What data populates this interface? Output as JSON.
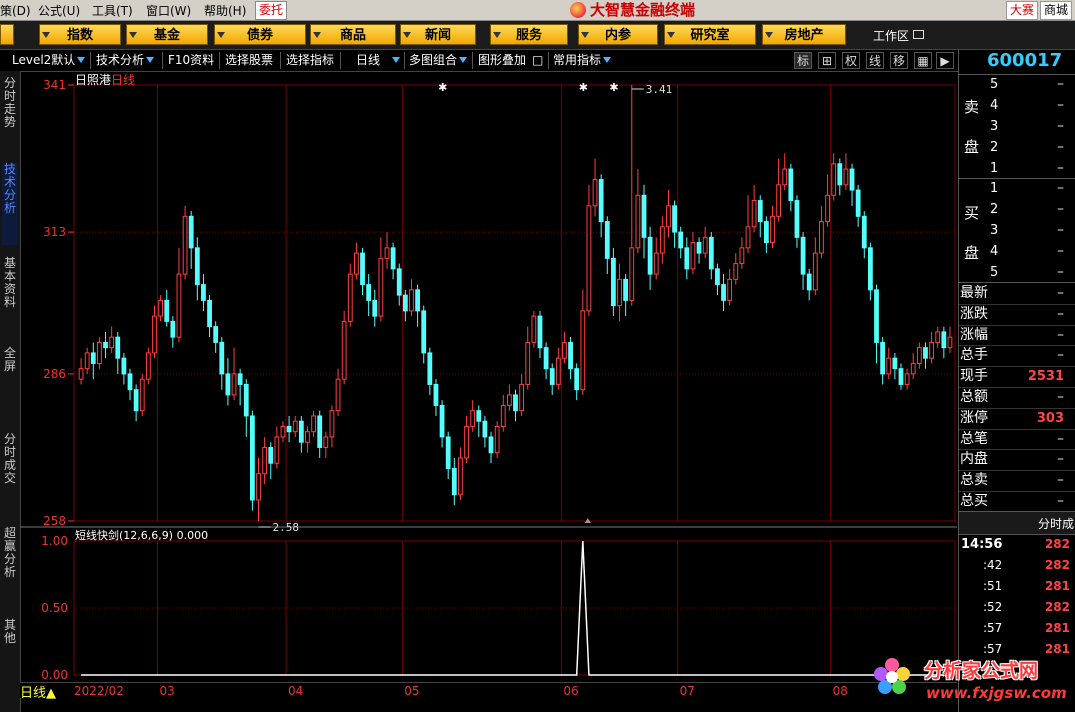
{
  "menu": {
    "items": [
      "策(D)",
      "公式(U)",
      "工具(T)",
      "窗口(W)",
      "帮助(H)"
    ],
    "weituo": "委托",
    "brand": "大智慧金融终端",
    "right_buttons": [
      "大赛",
      "商城"
    ]
  },
  "nav": {
    "items": [
      "指数",
      "基金",
      "债券",
      "商品",
      "新闻",
      "服务",
      "内参",
      "研究室",
      "房地产"
    ],
    "workzone": "工作区"
  },
  "toolbar": {
    "level2": "Level2默认",
    "tech": "技术分析",
    "f10": "F10资料",
    "select_stock": "选择股票",
    "select_ind": "选择指标",
    "period": "日线",
    "multi": "多图组合",
    "overlay": "图形叠加",
    "common_ind": "常用指标",
    "icons": [
      "标",
      "⊞",
      "权",
      "线",
      "移"
    ]
  },
  "left_tabs": [
    {
      "label": "分时走势",
      "active": false
    },
    {
      "label": "技术分析",
      "active": true
    },
    {
      "label": "基本资料",
      "active": false
    },
    {
      "label": "全屏",
      "active": false
    },
    {
      "label": "分时成交",
      "active": false
    },
    {
      "label": "超赢分析",
      "active": false
    },
    {
      "label": "其他",
      "active": false
    }
  ],
  "chart_data": {
    "type": "candlestick",
    "title": "日照港",
    "period_label": "日线",
    "indicator_name": "短线快剑(12,6,6,9)",
    "indicator_value": "0.000",
    "ylim": [
      2.58,
      3.41
    ],
    "y_ticks": [
      "341",
      "313",
      "286",
      "258"
    ],
    "y_tick_values": [
      3.41,
      3.13,
      2.86,
      2.58
    ],
    "indicator_ylim": [
      0,
      1
    ],
    "indicator_ticks": [
      "1.00",
      "0.50",
      "0.00"
    ],
    "high_marker": "3.41",
    "low_marker": "2.58",
    "x_labels": [
      "2022/02",
      "03",
      "04",
      "05",
      "06",
      "07",
      "08"
    ],
    "bottom_period": "日线",
    "colors": {
      "up": "#ff4040",
      "down": "#54ffff",
      "grid": "#7a0000",
      "axis": "#e33"
    },
    "candles": [
      [
        2.85,
        2.87,
        2.89,
        2.84
      ],
      [
        2.87,
        2.9,
        2.91,
        2.86
      ],
      [
        2.9,
        2.88,
        2.92,
        2.85
      ],
      [
        2.88,
        2.92,
        2.93,
        2.87
      ],
      [
        2.92,
        2.91,
        2.94,
        2.89
      ],
      [
        2.91,
        2.93,
        2.95,
        2.9
      ],
      [
        2.93,
        2.89,
        2.94,
        2.86
      ],
      [
        2.89,
        2.86,
        2.9,
        2.84
      ],
      [
        2.86,
        2.83,
        2.87,
        2.81
      ],
      [
        2.83,
        2.79,
        2.84,
        2.77
      ],
      [
        2.79,
        2.85,
        2.86,
        2.78
      ],
      [
        2.85,
        2.9,
        2.91,
        2.84
      ],
      [
        2.9,
        2.97,
        2.99,
        2.89
      ],
      [
        2.97,
        3.0,
        3.01,
        2.96
      ],
      [
        3.0,
        2.96,
        3.02,
        2.95
      ],
      [
        2.96,
        2.93,
        2.97,
        2.91
      ],
      [
        2.93,
        3.05,
        3.1,
        2.92
      ],
      [
        3.05,
        3.16,
        3.18,
        3.04
      ],
      [
        3.16,
        3.1,
        3.17,
        3.06
      ],
      [
        3.1,
        3.03,
        3.12,
        3.0
      ],
      [
        3.03,
        3.0,
        3.05,
        2.98
      ],
      [
        3.0,
        2.95,
        3.01,
        2.93
      ],
      [
        2.95,
        2.92,
        2.96,
        2.9
      ],
      [
        2.92,
        2.86,
        2.93,
        2.83
      ],
      [
        2.86,
        2.82,
        2.89,
        2.8
      ],
      [
        2.82,
        2.86,
        2.91,
        2.81
      ],
      [
        2.86,
        2.84,
        2.87,
        2.8
      ],
      [
        2.84,
        2.78,
        2.85,
        2.74
      ],
      [
        2.78,
        2.62,
        2.79,
        2.6
      ],
      [
        2.62,
        2.67,
        2.7,
        2.58
      ],
      [
        2.67,
        2.72,
        2.74,
        2.65
      ],
      [
        2.72,
        2.69,
        2.73,
        2.66
      ],
      [
        2.69,
        2.74,
        2.76,
        2.68
      ],
      [
        2.74,
        2.76,
        2.77,
        2.73
      ],
      [
        2.76,
        2.75,
        2.78,
        2.73
      ],
      [
        2.75,
        2.77,
        2.78,
        2.74
      ],
      [
        2.77,
        2.73,
        2.78,
        2.71
      ],
      [
        2.73,
        2.75,
        2.76,
        2.71
      ],
      [
        2.75,
        2.78,
        2.79,
        2.74
      ],
      [
        2.78,
        2.72,
        2.79,
        2.7
      ],
      [
        2.72,
        2.74,
        2.75,
        2.7
      ],
      [
        2.74,
        2.79,
        2.8,
        2.72
      ],
      [
        2.79,
        2.85,
        2.87,
        2.78
      ],
      [
        2.85,
        2.96,
        2.98,
        2.84
      ],
      [
        2.96,
        3.05,
        3.07,
        2.95
      ],
      [
        3.05,
        3.09,
        3.11,
        3.04
      ],
      [
        3.09,
        3.03,
        3.1,
        3.01
      ],
      [
        3.03,
        3.0,
        3.05,
        2.97
      ],
      [
        3.0,
        2.97,
        3.02,
        2.95
      ],
      [
        2.97,
        3.08,
        3.12,
        2.96
      ],
      [
        3.08,
        3.1,
        3.13,
        3.06
      ],
      [
        3.1,
        3.06,
        3.11,
        3.04
      ],
      [
        3.06,
        3.01,
        3.07,
        2.99
      ],
      [
        3.01,
        2.98,
        3.02,
        2.96
      ],
      [
        2.98,
        3.02,
        3.04,
        2.97
      ],
      [
        3.02,
        2.98,
        3.03,
        2.95
      ],
      [
        2.98,
        2.9,
        2.99,
        2.88
      ],
      [
        2.9,
        2.84,
        2.91,
        2.82
      ],
      [
        2.84,
        2.8,
        2.85,
        2.78
      ],
      [
        2.8,
        2.74,
        2.81,
        2.72
      ],
      [
        2.74,
        2.68,
        2.75,
        2.66
      ],
      [
        2.68,
        2.63,
        2.7,
        2.61
      ],
      [
        2.63,
        2.7,
        2.72,
        2.62
      ],
      [
        2.7,
        2.76,
        2.78,
        2.69
      ],
      [
        2.76,
        2.79,
        2.81,
        2.75
      ],
      [
        2.79,
        2.77,
        2.8,
        2.74
      ],
      [
        2.77,
        2.74,
        2.78,
        2.72
      ],
      [
        2.74,
        2.71,
        2.75,
        2.69
      ],
      [
        2.71,
        2.76,
        2.77,
        2.7
      ],
      [
        2.76,
        2.8,
        2.82,
        2.75
      ],
      [
        2.8,
        2.82,
        2.84,
        2.79
      ],
      [
        2.82,
        2.79,
        2.83,
        2.77
      ],
      [
        2.79,
        2.84,
        2.86,
        2.78
      ],
      [
        2.84,
        2.92,
        2.95,
        2.83
      ],
      [
        2.92,
        2.97,
        2.98,
        2.91
      ],
      [
        2.97,
        2.91,
        2.98,
        2.89
      ],
      [
        2.91,
        2.87,
        2.92,
        2.85
      ],
      [
        2.87,
        2.84,
        2.88,
        2.82
      ],
      [
        2.84,
        2.89,
        2.91,
        2.83
      ],
      [
        2.89,
        2.92,
        2.94,
        2.88
      ],
      [
        2.92,
        2.87,
        2.93,
        2.85
      ],
      [
        2.87,
        2.83,
        2.88,
        2.81
      ],
      [
        2.83,
        2.98,
        3.02,
        2.82
      ],
      [
        2.98,
        3.18,
        3.22,
        2.97
      ],
      [
        3.18,
        3.23,
        3.27,
        3.16
      ],
      [
        3.23,
        3.15,
        3.24,
        3.12
      ],
      [
        3.15,
        3.08,
        3.16,
        3.05
      ],
      [
        3.08,
        2.99,
        3.1,
        2.97
      ],
      [
        2.99,
        3.04,
        3.07,
        2.96
      ],
      [
        3.04,
        3.0,
        3.05,
        2.97
      ],
      [
        3.0,
        3.1,
        3.41,
        2.99
      ],
      [
        3.1,
        3.2,
        3.25,
        3.09
      ],
      [
        3.2,
        3.12,
        3.22,
        3.08
      ],
      [
        3.12,
        3.05,
        3.14,
        3.02
      ],
      [
        3.05,
        3.09,
        3.12,
        3.04
      ],
      [
        3.09,
        3.14,
        3.16,
        3.07
      ],
      [
        3.14,
        3.18,
        3.21,
        3.12
      ],
      [
        3.18,
        3.13,
        3.19,
        3.1
      ],
      [
        3.13,
        3.1,
        3.14,
        3.08
      ],
      [
        3.1,
        3.06,
        3.12,
        3.04
      ],
      [
        3.06,
        3.11,
        3.13,
        3.05
      ],
      [
        3.11,
        3.09,
        3.12,
        3.07
      ],
      [
        3.09,
        3.12,
        3.14,
        3.08
      ],
      [
        3.12,
        3.06,
        3.13,
        3.04
      ],
      [
        3.06,
        3.03,
        3.07,
        3.01
      ],
      [
        3.03,
        3.0,
        3.05,
        2.98
      ],
      [
        3.0,
        3.04,
        3.06,
        2.99
      ],
      [
        3.04,
        3.07,
        3.09,
        3.03
      ],
      [
        3.07,
        3.1,
        3.12,
        3.06
      ],
      [
        3.1,
        3.14,
        3.2,
        3.09
      ],
      [
        3.14,
        3.19,
        3.22,
        3.13
      ],
      [
        3.19,
        3.15,
        3.2,
        3.12
      ],
      [
        3.15,
        3.11,
        3.16,
        3.09
      ],
      [
        3.11,
        3.16,
        3.18,
        3.1
      ],
      [
        3.16,
        3.22,
        3.27,
        3.15
      ],
      [
        3.22,
        3.25,
        3.28,
        3.21
      ],
      [
        3.25,
        3.19,
        3.26,
        3.17
      ],
      [
        3.19,
        3.12,
        3.2,
        3.1
      ],
      [
        3.12,
        3.05,
        3.13,
        3.02
      ],
      [
        3.05,
        3.02,
        3.06,
        3.0
      ],
      [
        3.02,
        3.09,
        3.12,
        3.01
      ],
      [
        3.09,
        3.15,
        3.18,
        3.08
      ],
      [
        3.15,
        3.2,
        3.24,
        3.14
      ],
      [
        3.2,
        3.26,
        3.28,
        3.19
      ],
      [
        3.26,
        3.22,
        3.27,
        3.2
      ],
      [
        3.22,
        3.25,
        3.28,
        3.21
      ],
      [
        3.25,
        3.21,
        3.26,
        3.18
      ],
      [
        3.21,
        3.16,
        3.22,
        3.14
      ],
      [
        3.16,
        3.1,
        3.17,
        3.08
      ],
      [
        3.1,
        3.02,
        3.11,
        3.0
      ],
      [
        3.02,
        2.92,
        3.03,
        2.88
      ],
      [
        2.92,
        2.86,
        2.93,
        2.84
      ],
      [
        2.86,
        2.89,
        2.91,
        2.85
      ],
      [
        2.89,
        2.87,
        2.9,
        2.85
      ],
      [
        2.87,
        2.84,
        2.88,
        2.83
      ],
      [
        2.84,
        2.86,
        2.87,
        2.83
      ],
      [
        2.86,
        2.88,
        2.9,
        2.85
      ],
      [
        2.88,
        2.91,
        2.92,
        2.87
      ],
      [
        2.91,
        2.89,
        2.92,
        2.87
      ],
      [
        2.89,
        2.92,
        2.94,
        2.88
      ],
      [
        2.92,
        2.94,
        2.95,
        2.91
      ],
      [
        2.94,
        2.91,
        2.95,
        2.89
      ],
      [
        2.91,
        2.93,
        2.95,
        2.9
      ]
    ],
    "indicator_signal_index": 82
  },
  "right_panel": {
    "code": "600017",
    "sell_label": [
      "卖",
      "盘"
    ],
    "buy_label": [
      "买",
      "盘"
    ],
    "sell_levels": [
      "5",
      "4",
      "3",
      "2",
      "1"
    ],
    "buy_levels": [
      "1",
      "2",
      "3",
      "4",
      "5"
    ],
    "dash": "–",
    "stats": [
      {
        "label": "最新",
        "value": "–"
      },
      {
        "label": "涨跌",
        "value": "–"
      },
      {
        "label": "涨幅",
        "value": "–"
      },
      {
        "label": "总手",
        "value": "–"
      },
      {
        "label": "现手",
        "value": "2531"
      },
      {
        "label": "总额",
        "value": "–"
      },
      {
        "label": "涨停",
        "value": "303"
      },
      {
        "label": "总笔",
        "value": "–"
      },
      {
        "label": "内盘",
        "value": "–"
      },
      {
        "label": "总卖",
        "value": "–"
      },
      {
        "label": "总买",
        "value": "–"
      }
    ],
    "ticks_header": "分时成",
    "ticks": [
      {
        "time": "14:56",
        "price": "282"
      },
      {
        "time": ":42",
        "price": "282"
      },
      {
        "time": ":51",
        "price": "281"
      },
      {
        "time": ":52",
        "price": "282"
      },
      {
        "time": ":57",
        "price": "281"
      },
      {
        "time": ":57",
        "price": "281"
      }
    ]
  },
  "watermark": {
    "title": "分析家公式网",
    "url": "www.fxjgsw.com"
  }
}
